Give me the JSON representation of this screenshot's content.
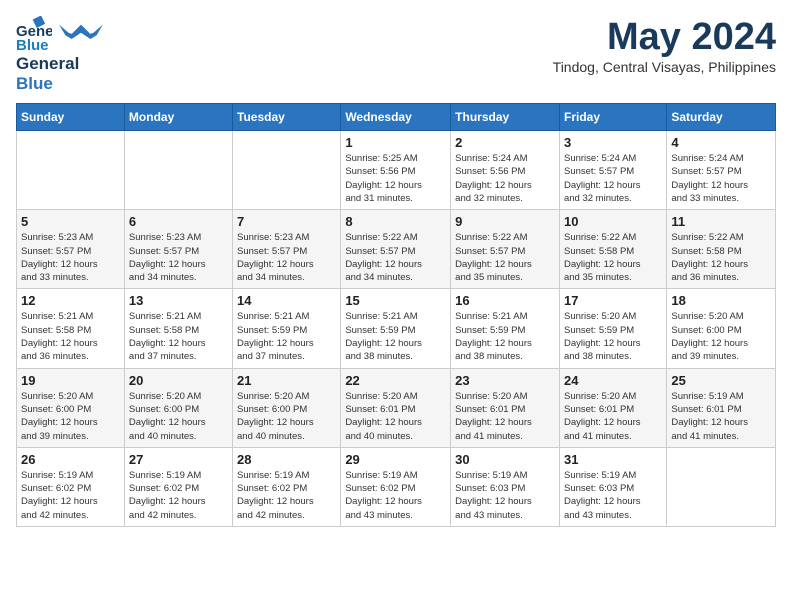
{
  "header": {
    "logo_line1": "General",
    "logo_line2": "Blue",
    "month": "May 2024",
    "location": "Tindog, Central Visayas, Philippines"
  },
  "weekdays": [
    "Sunday",
    "Monday",
    "Tuesday",
    "Wednesday",
    "Thursday",
    "Friday",
    "Saturday"
  ],
  "weeks": [
    [
      {
        "day": "",
        "info": ""
      },
      {
        "day": "",
        "info": ""
      },
      {
        "day": "",
        "info": ""
      },
      {
        "day": "1",
        "info": "Sunrise: 5:25 AM\nSunset: 5:56 PM\nDaylight: 12 hours\nand 31 minutes."
      },
      {
        "day": "2",
        "info": "Sunrise: 5:24 AM\nSunset: 5:56 PM\nDaylight: 12 hours\nand 32 minutes."
      },
      {
        "day": "3",
        "info": "Sunrise: 5:24 AM\nSunset: 5:57 PM\nDaylight: 12 hours\nand 32 minutes."
      },
      {
        "day": "4",
        "info": "Sunrise: 5:24 AM\nSunset: 5:57 PM\nDaylight: 12 hours\nand 33 minutes."
      }
    ],
    [
      {
        "day": "5",
        "info": "Sunrise: 5:23 AM\nSunset: 5:57 PM\nDaylight: 12 hours\nand 33 minutes."
      },
      {
        "day": "6",
        "info": "Sunrise: 5:23 AM\nSunset: 5:57 PM\nDaylight: 12 hours\nand 34 minutes."
      },
      {
        "day": "7",
        "info": "Sunrise: 5:23 AM\nSunset: 5:57 PM\nDaylight: 12 hours\nand 34 minutes."
      },
      {
        "day": "8",
        "info": "Sunrise: 5:22 AM\nSunset: 5:57 PM\nDaylight: 12 hours\nand 34 minutes."
      },
      {
        "day": "9",
        "info": "Sunrise: 5:22 AM\nSunset: 5:57 PM\nDaylight: 12 hours\nand 35 minutes."
      },
      {
        "day": "10",
        "info": "Sunrise: 5:22 AM\nSunset: 5:58 PM\nDaylight: 12 hours\nand 35 minutes."
      },
      {
        "day": "11",
        "info": "Sunrise: 5:22 AM\nSunset: 5:58 PM\nDaylight: 12 hours\nand 36 minutes."
      }
    ],
    [
      {
        "day": "12",
        "info": "Sunrise: 5:21 AM\nSunset: 5:58 PM\nDaylight: 12 hours\nand 36 minutes."
      },
      {
        "day": "13",
        "info": "Sunrise: 5:21 AM\nSunset: 5:58 PM\nDaylight: 12 hours\nand 37 minutes."
      },
      {
        "day": "14",
        "info": "Sunrise: 5:21 AM\nSunset: 5:59 PM\nDaylight: 12 hours\nand 37 minutes."
      },
      {
        "day": "15",
        "info": "Sunrise: 5:21 AM\nSunset: 5:59 PM\nDaylight: 12 hours\nand 38 minutes."
      },
      {
        "day": "16",
        "info": "Sunrise: 5:21 AM\nSunset: 5:59 PM\nDaylight: 12 hours\nand 38 minutes."
      },
      {
        "day": "17",
        "info": "Sunrise: 5:20 AM\nSunset: 5:59 PM\nDaylight: 12 hours\nand 38 minutes."
      },
      {
        "day": "18",
        "info": "Sunrise: 5:20 AM\nSunset: 6:00 PM\nDaylight: 12 hours\nand 39 minutes."
      }
    ],
    [
      {
        "day": "19",
        "info": "Sunrise: 5:20 AM\nSunset: 6:00 PM\nDaylight: 12 hours\nand 39 minutes."
      },
      {
        "day": "20",
        "info": "Sunrise: 5:20 AM\nSunset: 6:00 PM\nDaylight: 12 hours\nand 40 minutes."
      },
      {
        "day": "21",
        "info": "Sunrise: 5:20 AM\nSunset: 6:00 PM\nDaylight: 12 hours\nand 40 minutes."
      },
      {
        "day": "22",
        "info": "Sunrise: 5:20 AM\nSunset: 6:01 PM\nDaylight: 12 hours\nand 40 minutes."
      },
      {
        "day": "23",
        "info": "Sunrise: 5:20 AM\nSunset: 6:01 PM\nDaylight: 12 hours\nand 41 minutes."
      },
      {
        "day": "24",
        "info": "Sunrise: 5:20 AM\nSunset: 6:01 PM\nDaylight: 12 hours\nand 41 minutes."
      },
      {
        "day": "25",
        "info": "Sunrise: 5:19 AM\nSunset: 6:01 PM\nDaylight: 12 hours\nand 41 minutes."
      }
    ],
    [
      {
        "day": "26",
        "info": "Sunrise: 5:19 AM\nSunset: 6:02 PM\nDaylight: 12 hours\nand 42 minutes."
      },
      {
        "day": "27",
        "info": "Sunrise: 5:19 AM\nSunset: 6:02 PM\nDaylight: 12 hours\nand 42 minutes."
      },
      {
        "day": "28",
        "info": "Sunrise: 5:19 AM\nSunset: 6:02 PM\nDaylight: 12 hours\nand 42 minutes."
      },
      {
        "day": "29",
        "info": "Sunrise: 5:19 AM\nSunset: 6:02 PM\nDaylight: 12 hours\nand 43 minutes."
      },
      {
        "day": "30",
        "info": "Sunrise: 5:19 AM\nSunset: 6:03 PM\nDaylight: 12 hours\nand 43 minutes."
      },
      {
        "day": "31",
        "info": "Sunrise: 5:19 AM\nSunset: 6:03 PM\nDaylight: 12 hours\nand 43 minutes."
      },
      {
        "day": "",
        "info": ""
      }
    ]
  ]
}
